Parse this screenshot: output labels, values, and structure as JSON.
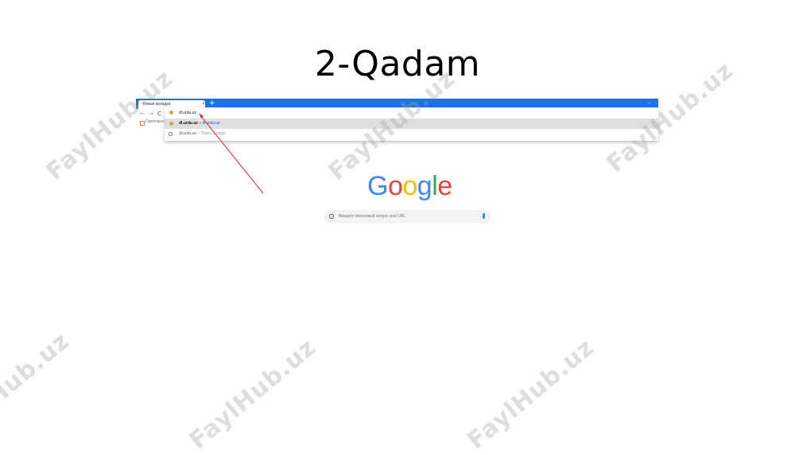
{
  "slide": {
    "title": "2-Qadam"
  },
  "browser": {
    "tab_title": "Новая вкладка",
    "tab_close": "×",
    "new_tab": "+",
    "window_min": "–",
    "nav": {
      "back": "←",
      "forward": "→",
      "reload": "C"
    },
    "bookmarks_label": "Приложения",
    "omnibox": {
      "typed": "dl.urdu.uz",
      "suggestions": [
        {
          "bold": "dl.urdu.uz",
          "separator": " – ",
          "link": "dl.urdu.uz",
          "close": "×"
        },
        {
          "query": "dl.urdu.uz",
          "suffix": " – Поиск Google"
        }
      ]
    }
  },
  "google": {
    "letters": [
      "G",
      "o",
      "o",
      "g",
      "l",
      "e"
    ],
    "colors": [
      "#4285f4",
      "#ea4335",
      "#fbbc05",
      "#4285f4",
      "#34a853",
      "#ea4335"
    ],
    "search_placeholder": "Введите поисковый запрос или URL"
  },
  "watermark": {
    "text": "FaylHub.uz"
  },
  "colors": {
    "tabstrip": "#1a73e8",
    "arrow": "#e03030"
  }
}
